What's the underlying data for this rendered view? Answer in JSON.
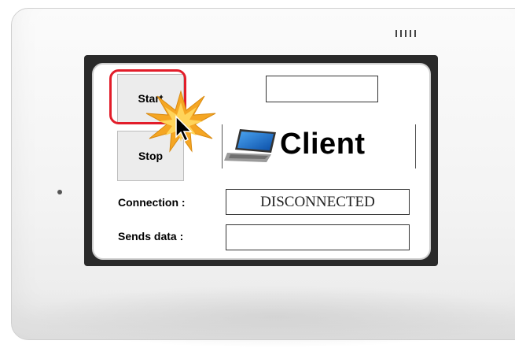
{
  "device": {
    "buttons": {
      "start_label": "Start",
      "stop_label": "Stop"
    },
    "logo": {
      "text": "Client",
      "icon": "laptop-icon"
    },
    "connection": {
      "label": "Connection :",
      "value": "DISCONNECTED"
    },
    "sends_data": {
      "label": "Sends data :",
      "value": ""
    },
    "top_field": {
      "value": ""
    },
    "highlight_color": "#e21d2a",
    "burst_color": "#f5a623"
  }
}
